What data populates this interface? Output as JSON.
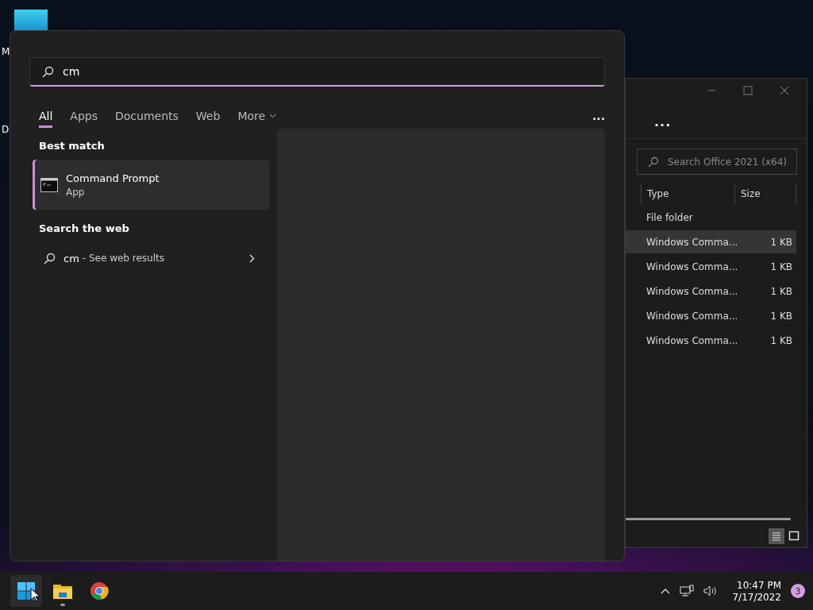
{
  "desktop": {
    "icons": [
      {
        "label": "M"
      },
      {
        "label": "D"
      }
    ]
  },
  "explorer": {
    "search": {
      "placeholder": "Search Office 2021 (x64)"
    },
    "more": "...",
    "columns": [
      "Type",
      "Size"
    ],
    "rows": [
      {
        "type": "File folder",
        "size": "",
        "selected": false
      },
      {
        "type": "Windows Comma...",
        "size": "1 KB",
        "selected": true
      },
      {
        "type": "Windows Comma...",
        "size": "1 KB",
        "selected": false
      },
      {
        "type": "Windows Comma...",
        "size": "1 KB",
        "selected": false
      },
      {
        "type": "Windows Comma...",
        "size": "1 KB",
        "selected": false
      },
      {
        "type": "Windows Comma...",
        "size": "1 KB",
        "selected": false
      }
    ],
    "views": [
      {
        "kind": "details",
        "selected": true
      },
      {
        "kind": "tiles",
        "selected": false
      }
    ]
  },
  "search_flyout": {
    "query": "cm",
    "tabs": [
      {
        "label": "All",
        "selected": true
      },
      {
        "label": "Apps",
        "selected": false
      },
      {
        "label": "Documents",
        "selected": false
      },
      {
        "label": "Web",
        "selected": false
      },
      {
        "label": "More",
        "selected": false
      }
    ],
    "more": "...",
    "best_match_heading": "Best match",
    "best_match": {
      "name": "Command Prompt",
      "type": "App",
      "selected": true
    },
    "web_heading": "Search the web",
    "web_result": {
      "query": "cm",
      "hint": "- See web results"
    }
  },
  "taskbar": {
    "apps": [
      {
        "kind": "start",
        "selected": true
      },
      {
        "kind": "explorer",
        "selected": false
      },
      {
        "kind": "browser",
        "selected": false
      }
    ],
    "time": "10:47 PM",
    "date": "7/17/2022",
    "notifications": "3"
  }
}
